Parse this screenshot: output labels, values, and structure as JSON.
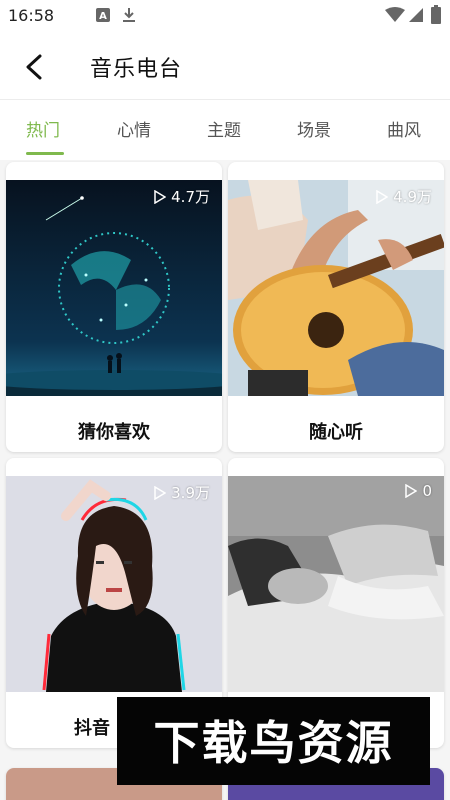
{
  "status_bar": {
    "time": "16:58",
    "icons": [
      "a-icon",
      "download-icon",
      "wifi-icon",
      "signal-icon",
      "battery-icon"
    ]
  },
  "header": {
    "title": "音乐电台"
  },
  "tabs": [
    {
      "label": "热门",
      "active": true
    },
    {
      "label": "心情",
      "active": false
    },
    {
      "label": "主题",
      "active": false
    },
    {
      "label": "场景",
      "active": false
    },
    {
      "label": "曲风",
      "active": false
    }
  ],
  "cards": [
    {
      "title": "猜你喜欢",
      "play_count": "4.7万"
    },
    {
      "title": "随心听",
      "play_count": "4.9万"
    },
    {
      "title": "抖音",
      "play_count": "3.9万"
    },
    {
      "title": "",
      "play_count": "0"
    }
  ],
  "watermark": {
    "text": "下载鸟资源"
  },
  "colors": {
    "accent": "#7fb94d"
  }
}
